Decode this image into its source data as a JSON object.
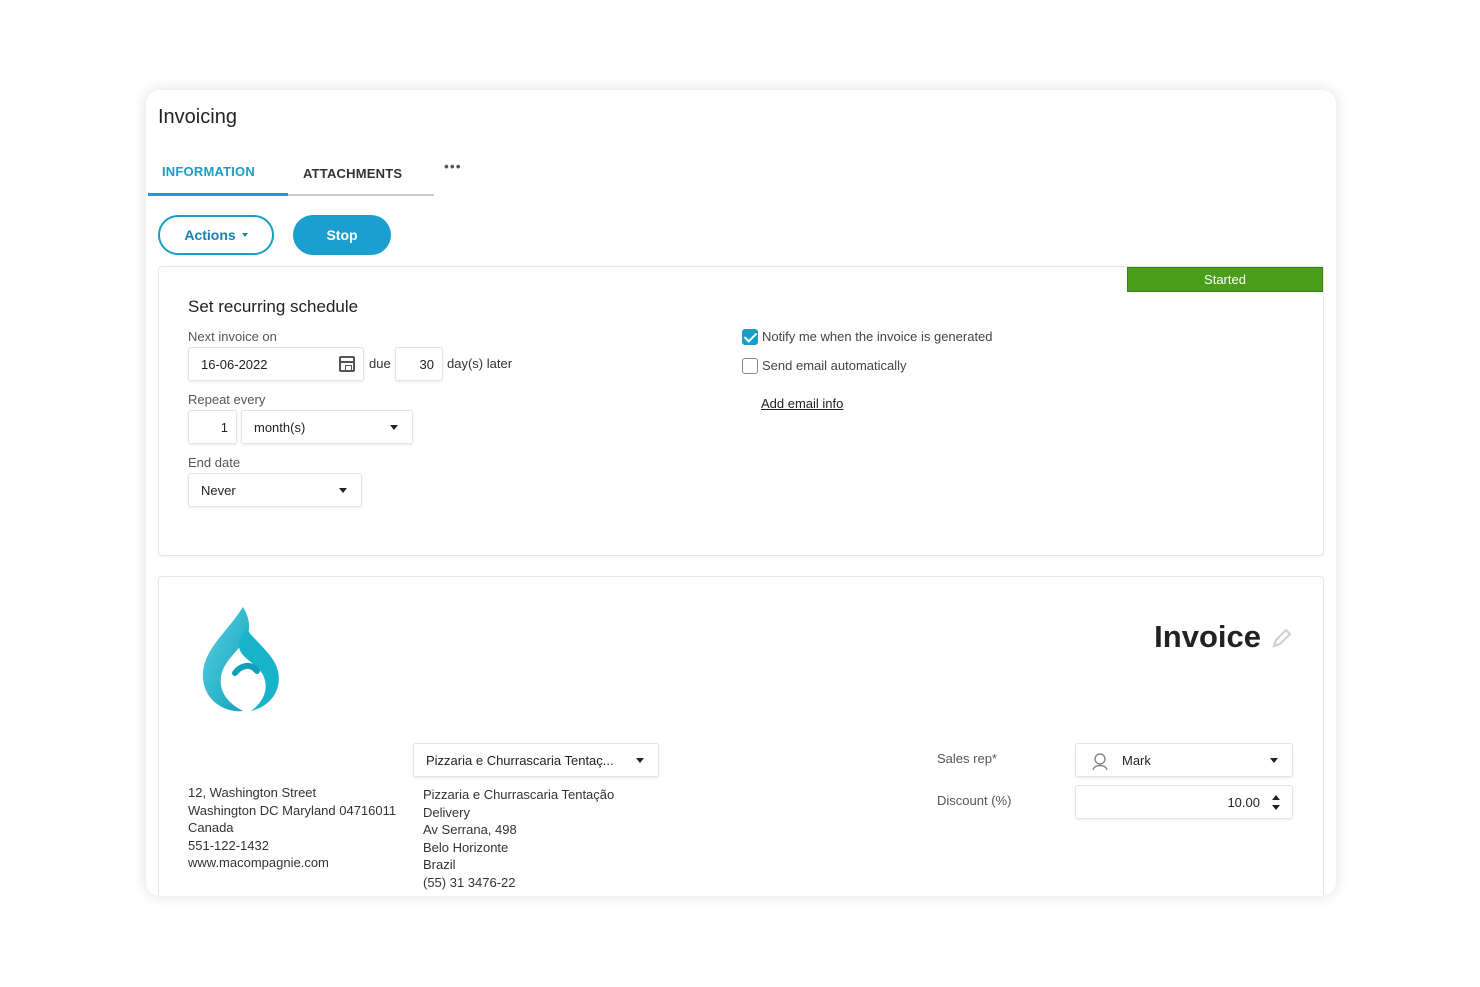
{
  "page": {
    "title": "Invoicing"
  },
  "tabs": [
    {
      "label": "INFORMATION",
      "active": true
    },
    {
      "label": "ATTACHMENTS",
      "active": false
    }
  ],
  "tabs_more": "•••",
  "toolbar": {
    "actions_label": "Actions",
    "stop_label": "Stop"
  },
  "schedule": {
    "status": "Started",
    "title": "Set recurring schedule",
    "next_invoice_label": "Next invoice on",
    "next_invoice_value": "16-06-2022",
    "due_label": "due",
    "due_days": "30",
    "days_later_label": "day(s) later",
    "repeat_label": "Repeat every",
    "repeat_value": "1",
    "repeat_unit": "month(s)",
    "end_date_label": "End date",
    "end_date_value": "Never",
    "notify_label": "Notify me when the invoice is generated",
    "notify_checked": true,
    "send_email_label": "Send email automatically",
    "send_email_checked": false,
    "add_email_link": "Add email info"
  },
  "invoice": {
    "title": "Invoice",
    "company_address": [
      "12, Washington Street",
      "Washington DC Maryland 04716011",
      "Canada",
      "551-122-1432",
      "www.macompagnie.com"
    ],
    "client_select": "Pizzaria e Churrascaria Tentaç...",
    "client_address": [
      "Pizzaria e Churrascaria Tentação",
      "Delivery",
      "Av Serrana, 498",
      "Belo Horizonte",
      "Brazil",
      "(55) 31 3476-22"
    ],
    "sales_rep_label": "Sales rep*",
    "sales_rep_value": "Mark",
    "discount_label": "Discount (%)",
    "discount_value": "10.00"
  },
  "colors": {
    "accent": "#1b9dc6",
    "status_started": "#4a9e1a"
  }
}
